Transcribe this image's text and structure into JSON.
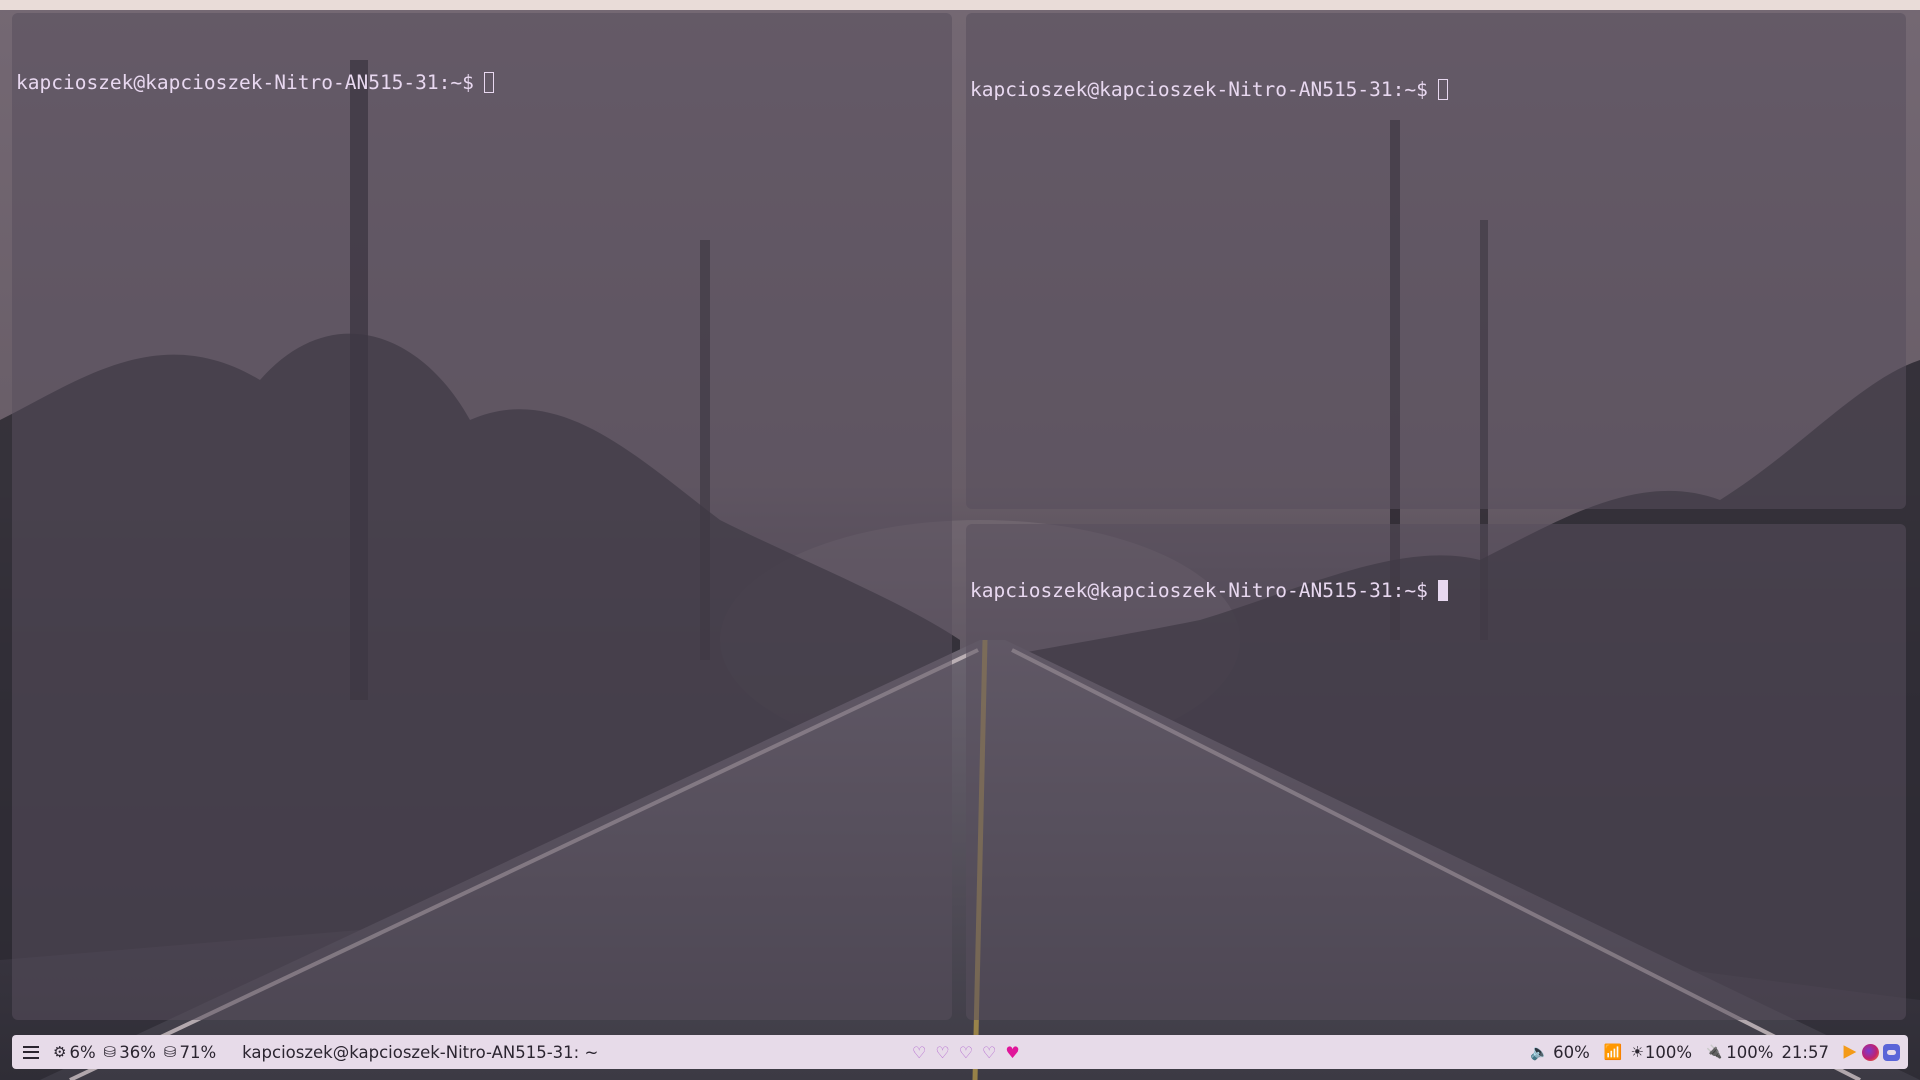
{
  "colors": {
    "terminal_text": "#e8d8f0",
    "bar_background": "#e7dbe9",
    "bar_text": "#2b2530",
    "heart_empty": "#b46ad0",
    "heart_full": "#e0169a",
    "volume_icon": "#3b7fd0",
    "wifi_icon": "#e08a10"
  },
  "terminals": {
    "left": {
      "prompt": "kapcioszek@kapcioszek-Nitro-AN515-31:~$",
      "cursor": "hollow"
    },
    "top_right": {
      "prompt": "kapcioszek@kapcioszek-Nitro-AN515-31:~$",
      "cursor": "hollow"
    },
    "bottom_right": {
      "prompt": "kapcioszek@kapcioszek-Nitro-AN515-31:~$",
      "cursor": "solid",
      "focused": true
    }
  },
  "bar": {
    "menu_icon": "hamburger-menu-icon",
    "cpu": {
      "icon": "cpu-icon",
      "glyph": "⚙",
      "value": "6%"
    },
    "memory": {
      "icon": "memory-icon",
      "glyph": "⛁",
      "value": "36%"
    },
    "disk": {
      "icon": "disk-icon",
      "glyph": "⛁",
      "value": "71%"
    },
    "window_title": "kapcioszek@kapcioszek-Nitro-AN515-31: ~",
    "workspaces": [
      {
        "glyph": "♡",
        "active": false
      },
      {
        "glyph": "♡",
        "active": false
      },
      {
        "glyph": "♡",
        "active": false
      },
      {
        "glyph": "♡",
        "active": false
      },
      {
        "glyph": "♥",
        "active": true
      }
    ],
    "volume": {
      "icon": "volume-icon",
      "glyph": "🔈",
      "value": "60%"
    },
    "network": {
      "icon": "wifi-icon",
      "glyph": "📶",
      "value": ""
    },
    "brightness": {
      "icon": "brightness-icon",
      "glyph": "☀",
      "value": "100%"
    },
    "battery": {
      "icon": "battery-plug-icon",
      "glyph": "🔌",
      "value": "100%"
    },
    "clock": "21:57",
    "tray": [
      "vlc-icon",
      "firefox-icon",
      "discord-icon"
    ]
  }
}
